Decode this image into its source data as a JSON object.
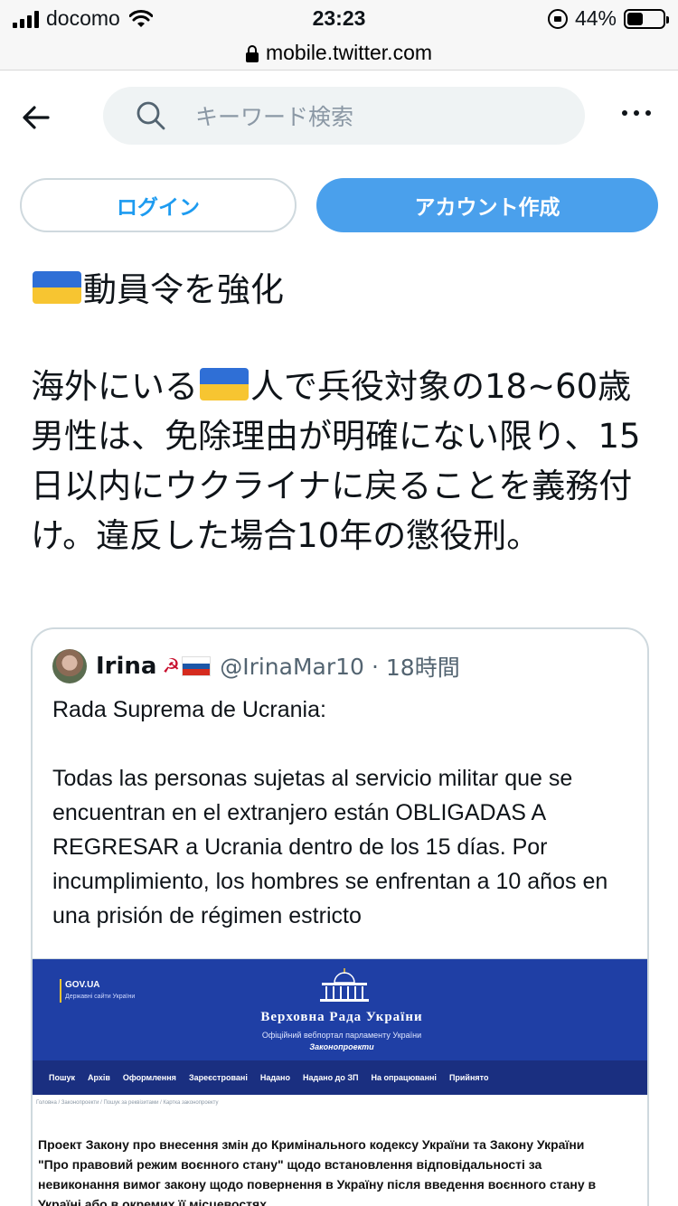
{
  "status_bar": {
    "carrier": "docomo",
    "time": "23:23",
    "battery": "44%",
    "battery_level": 0.44
  },
  "browser": {
    "url": "mobile.twitter.com"
  },
  "header": {
    "search_placeholder": "キーワード検索"
  },
  "auth": {
    "login_label": "ログイン",
    "signup_label": "アカウント作成"
  },
  "tweet": {
    "title": "動員令を強化",
    "body_before_flag": "海外にいる",
    "body_after_flag": "人で兵役対象の18~60歳男性は、免除理由が明確にない限り、15日以内にウクライナに戻ることを義務付け。違反した場合10年の懲役刑。"
  },
  "quoted": {
    "name": "Irina",
    "name_emoji": "☭",
    "handle": "@IrinaMar10",
    "separator": "·",
    "time": "18時間",
    "text": "Rada Suprema de Ucrania:\n\nTodas las personas sujetas al servicio militar que se encuentran en el extranjero están OBLIGADAS A REGRESAR a Ucrania dentro de los 15 días. Por incumplimiento, los hombres se enfrentan a 10 años en una prisión de régimen estricto",
    "image": {
      "gov_logo": "GOV.UA",
      "gov_logo_sub": "Державні сайти України",
      "title": "Верховна Рада України",
      "subtitle": "Офіційний вебпортал парламенту України",
      "subtitle2": "Законопроекти",
      "nav": [
        "Пошук",
        "Архів",
        "Оформлення",
        "Зареєстровані",
        "Надано",
        "Надано до ЗП",
        "На опрацюванні",
        "Прийнято"
      ],
      "breadcrumbs": "Головна  /  Законопроекти  /  Пошук за реквізитами  /  Картка законопроекту",
      "doc_title": "Проект Закону про внесення змін до Кримінального кодексу України та Закону України \"Про правовий режим воєнного стану\" щодо встановлення відповідальності за невиконання вимог закону щодо повернення в Україну після введення воєнного стану в Україні або в окремих її місцевостях"
    }
  },
  "colors": {
    "accent": "#1d9bf0",
    "signup_bg": "#4aa0ec",
    "rada_blue": "#1f3fa5",
    "flag_blue": "#2f6fd6",
    "flag_yellow": "#f7c531"
  }
}
